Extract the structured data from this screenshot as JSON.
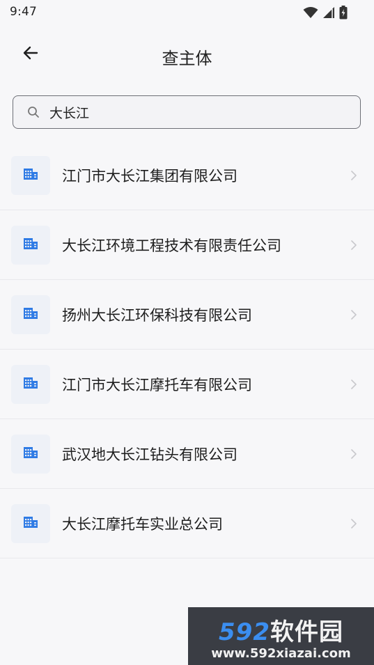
{
  "status_bar": {
    "time": "9:47",
    "icons": [
      "wifi-icon",
      "signal-icon",
      "battery-icon"
    ]
  },
  "header": {
    "title": "查主体",
    "back_icon": "arrow-left-icon"
  },
  "search": {
    "value": "大长江",
    "icon": "search-icon"
  },
  "results": [
    {
      "label": "江门市大长江集团有限公司",
      "icon": "building-icon"
    },
    {
      "label": "大长江环境工程技术有限责任公司",
      "icon": "building-icon"
    },
    {
      "label": "扬州大长江环保科技有限公司",
      "icon": "building-icon"
    },
    {
      "label": "江门市大长江摩托车有限公司",
      "icon": "building-icon"
    },
    {
      "label": "武汉地大长江钻头有限公司",
      "icon": "building-icon"
    },
    {
      "label": "大长江摩托车实业总公司",
      "icon": "building-icon"
    }
  ],
  "watermark": {
    "brand_num": "592",
    "brand_cn": "软件园",
    "url": "www.592xiazai.com"
  },
  "colors": {
    "background": "#f7f7f9",
    "accent_icon": "#2f7be5",
    "icon_box": "#eef1f7",
    "watermark_bg": "#3a3d44",
    "watermark_brand": "#3b8ef0"
  }
}
